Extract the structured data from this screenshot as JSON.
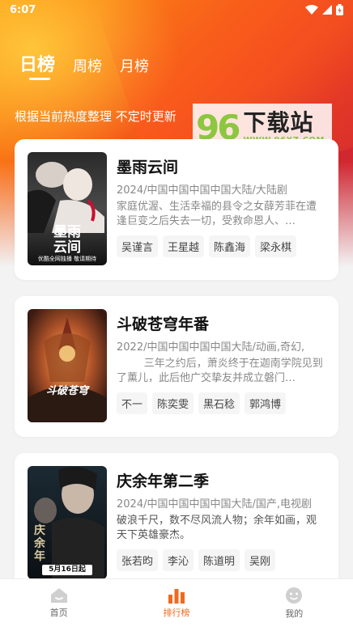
{
  "status": {
    "time": "6:07"
  },
  "tabs": [
    {
      "label": "日榜"
    },
    {
      "label": "周榜"
    },
    {
      "label": "月榜"
    }
  ],
  "subtitle": "根据当前热度整理 不定时更新",
  "watermark": {
    "logo": "96",
    "title": "下载站",
    "url": "WWW.96XZ.COM"
  },
  "items": [
    {
      "title": "墨雨云间",
      "meta": "2024/中国中国中国中国大陆/大陆剧",
      "desc": "家庭优渥、生活幸福的县令之女薛芳菲在遭逢巨变之后失去一切，受救命恩人、…",
      "actors": [
        "吴谨言",
        "王星越",
        "陈鑫海",
        "梁永棋"
      ],
      "poster": {
        "big_title": "墨雨云间",
        "caption": "优酷全网独播 敬请期待"
      }
    },
    {
      "title": "斗破苍穹年番",
      "meta": "2022/中国中国中国中国大陆/动画,奇幻,",
      "desc": "三年之约后，萧炎终于在迦南学院见到了薰儿，此后他广交挚友并成立磐门…",
      "actors": [
        "不一",
        "陈奕雯",
        "黑石稔",
        "郭鸿博"
      ],
      "poster": {
        "big_title": "斗破苍穹"
      }
    },
    {
      "title": "庆余年第二季",
      "meta": "2024/中国中国中国中国大陆/国产,电视剧",
      "desc": "破浪千尺，数不尽风流人物；余年如画，观天下英雄豪杰。",
      "actors": [
        "张若昀",
        "李沁",
        "陈道明",
        "吴刚"
      ],
      "poster": {
        "big_title": "庆余年",
        "caption": "5月16日起"
      }
    }
  ],
  "nav": [
    {
      "label": "首页",
      "icon": "home-icon"
    },
    {
      "label": "排行榜",
      "icon": "ranking-icon"
    },
    {
      "label": "我的",
      "icon": "profile-icon"
    }
  ],
  "colors": {
    "accent": "#f06a1c",
    "hero_start": "#ff9a10",
    "hero_end": "#c8283a"
  }
}
